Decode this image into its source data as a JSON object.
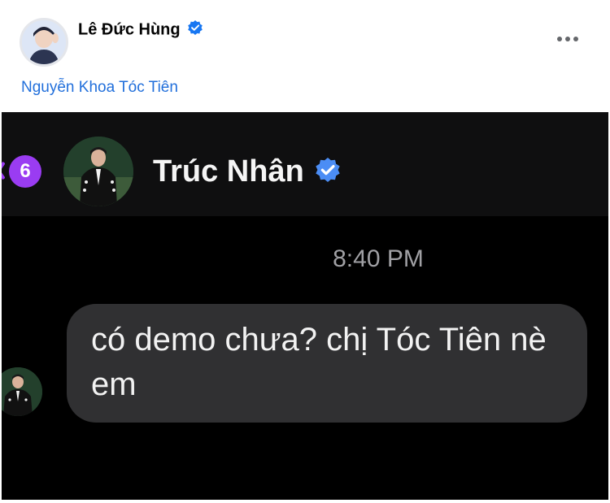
{
  "post": {
    "author_name": "Lê Đức Hùng",
    "tagged_person": "Nguyễn Khoa Tóc Tiên",
    "verified_color": "#1877f2",
    "link_color": "#216fdb"
  },
  "chat": {
    "unread_count": "6",
    "contact_name": "Trúc Nhân",
    "timestamp": "8:40 PM",
    "message": "có demo chưa? chị Tóc Tiên nè em",
    "bubble_color": "#303032",
    "badge_color": "#9a3cf2",
    "verified_color": "#4b8df5"
  }
}
